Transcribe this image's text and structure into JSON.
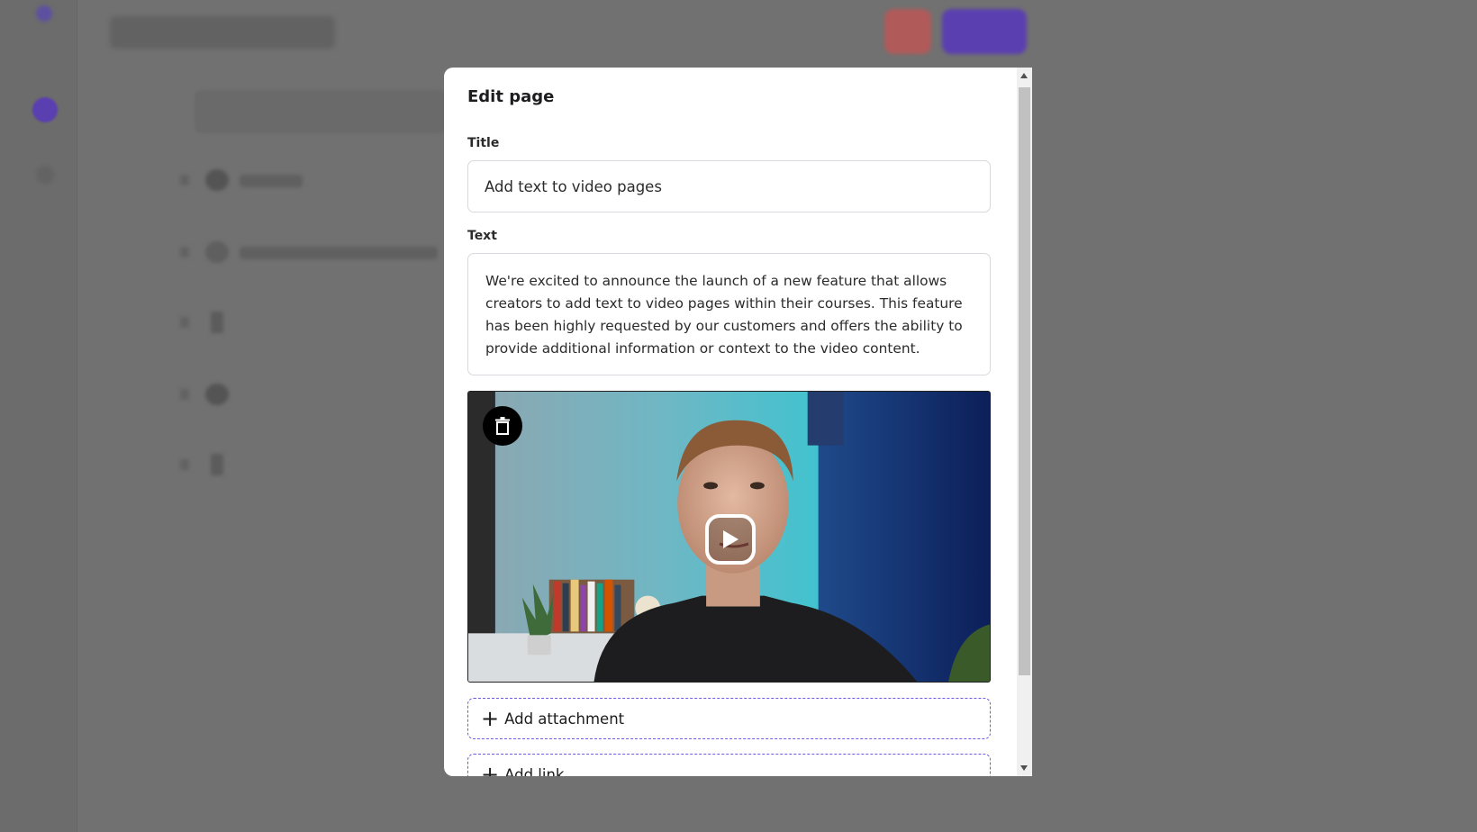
{
  "modal": {
    "title": "Edit page",
    "title_label": "Title",
    "title_value": "Add text to video pages",
    "text_label": "Text",
    "text_value": "We're excited to announce the launch of a new feature that allows creators to add text to video pages within their courses. This feature has been highly requested by our customers and offers the ability to provide additional information or context to the video content.",
    "video": {
      "delete_icon": "trash-icon",
      "play_icon": "play-icon"
    },
    "add_attachment_label": "Add attachment",
    "add_link_label": "Add link",
    "add_icon": "plus-icon"
  },
  "colors": {
    "overlay": "#6e6e6e",
    "dashed_border": "#6f5be6",
    "accent_purple": "#5a3fb0",
    "accent_red": "#b05a5a"
  }
}
